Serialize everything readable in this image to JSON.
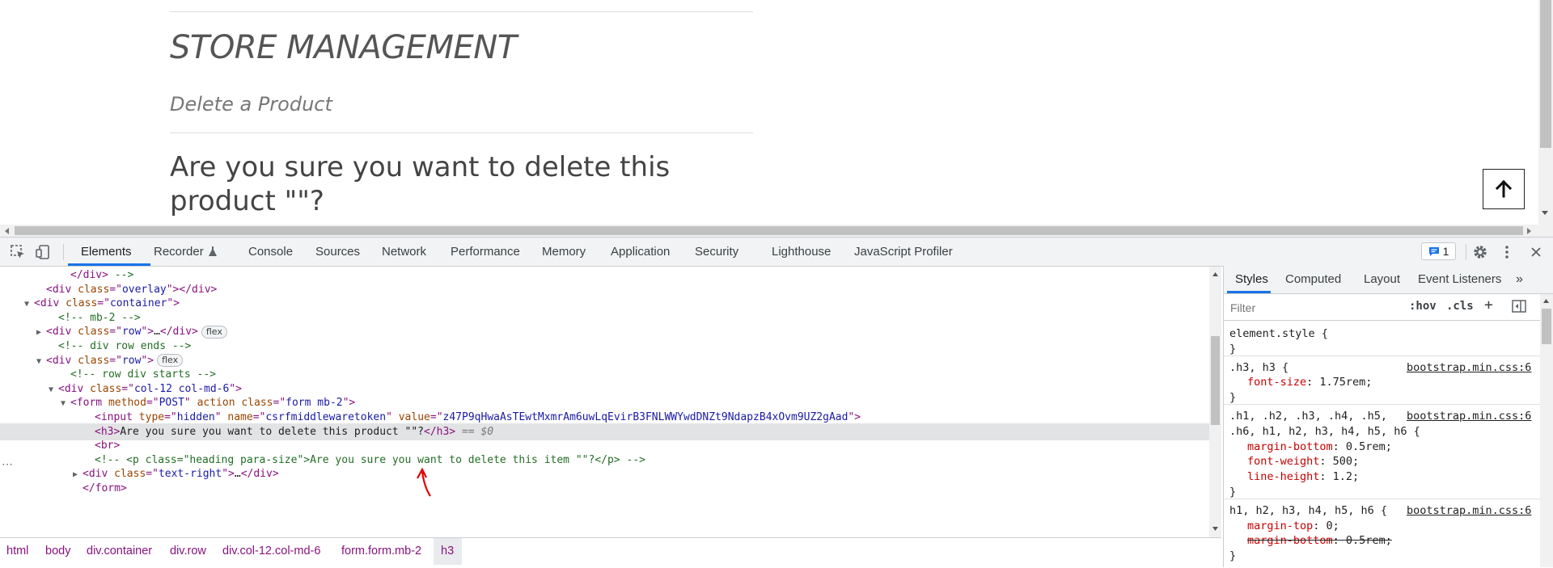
{
  "page": {
    "store_title": "STORE MANAGEMENT",
    "subtitle": "Delete a Product",
    "confirm_text": "Are you sure you want to delete this product \"\"?",
    "scroll_top_icon": "arrow-up-icon"
  },
  "devtools": {
    "tabs": [
      "Elements",
      "Recorder",
      "Console",
      "Sources",
      "Network",
      "Performance",
      "Memory",
      "Application",
      "Security",
      "Lighthouse",
      "JavaScript Profiler"
    ],
    "active_tab": "Elements",
    "issues_count": "1",
    "dom_lines": [
      {
        "indent": 5,
        "tri": "",
        "html": "<span class='tag'>&lt;/div&gt;</span> <span class='cmt'>--&gt;</span>"
      },
      {
        "indent": 3,
        "tri": "",
        "html": "<span class='tag'>&lt;div</span> <span class='attr'>class</span><span class='tag'>=\"</span><span class='val'>overlay</span><span class='tag'>\"&gt;&lt;/div&gt;</span>"
      },
      {
        "indent": 2,
        "tri": "▼",
        "html": "<span class='tag'>&lt;div</span> <span class='attr'>class</span><span class='tag'>=\"</span><span class='val'>container</span><span class='tag'>\"&gt;</span>"
      },
      {
        "indent": 4,
        "tri": "",
        "html": "<span class='cmt'>&lt;!-- mb-2 --&gt;</span>"
      },
      {
        "indent": 3,
        "tri": "▶",
        "html": "<span class='tag'>&lt;div</span> <span class='attr'>class</span><span class='tag'>=\"</span><span class='val'>row</span><span class='tag'>\"&gt;</span>…<span class='tag'>&lt;/div&gt;</span><span class='flexbadge'>flex</span>"
      },
      {
        "indent": 4,
        "tri": "",
        "html": "<span class='cmt'>&lt;!-- div row ends --&gt;</span>"
      },
      {
        "indent": 3,
        "tri": "▼",
        "html": "<span class='tag'>&lt;div</span> <span class='attr'>class</span><span class='tag'>=\"</span><span class='val'>row</span><span class='tag'>\"&gt;</span><span class='flexbadge'>flex</span>"
      },
      {
        "indent": 5,
        "tri": "",
        "html": "<span class='cmt'>&lt;!-- row div starts --&gt;</span>"
      },
      {
        "indent": 4,
        "tri": "▼",
        "html": "<span class='tag'>&lt;div</span> <span class='attr'>class</span><span class='tag'>=\"</span><span class='val'>col-12 col-md-6</span><span class='tag'>\"&gt;</span>"
      },
      {
        "indent": 5,
        "tri": "▼",
        "html": "<span class='tag'>&lt;form</span> <span class='attr'>method</span><span class='tag'>=\"</span><span class='val'>POST</span><span class='tag'>\"</span> <span class='attr'>action</span> <span class='attr'>class</span><span class='tag'>=\"</span><span class='val'>form mb-2</span><span class='tag'>\"&gt;</span>"
      },
      {
        "indent": 7,
        "tri": "",
        "html": "<span class='tag'>&lt;input</span> <span class='attr'>type</span><span class='tag'>=\"</span><span class='val'>hidden</span><span class='tag'>\"</span> <span class='attr'>name</span><span class='tag'>=\"</span><span class='val'>csrfmiddlewaretoken</span><span class='tag'>\"</span> <span class='attr'>value</span><span class='tag'>=\"</span><span class='val'>z47P9qHwaAsTEwtMxmrAm6uwLqEvirB3FNLWWYwdDNZt9NdapzB4xOvm9UZ2gAad</span><span class='tag'>\"&gt;</span>"
      },
      {
        "indent": 7,
        "tri": "",
        "sel": true,
        "html": "<span class='tag'>&lt;h3&gt;</span>Are you sure you want to delete this product \"\"?<span class='tag'>&lt;/h3&gt;</span> <span class='dim'>== $0</span>"
      },
      {
        "indent": 7,
        "tri": "",
        "html": "<span class='tag'>&lt;br&gt;</span>"
      },
      {
        "indent": 7,
        "tri": "",
        "html": "<span class='cmt'>&lt;!-- &lt;p class=\"heading para-size\"&gt;Are you sure you want to delete this item \"\"?&lt;/p&gt; --&gt;</span>"
      },
      {
        "indent": 6,
        "tri": "▶",
        "html": "<span class='tag'>&lt;div</span> <span class='attr'>class</span><span class='tag'>=\"</span><span class='val'>text-right</span><span class='tag'>\"&gt;</span>…<span class='tag'>&lt;/div&gt;</span>"
      },
      {
        "indent": 6,
        "tri": "",
        "html": "<span class='tag'>&lt;/form&gt;</span>"
      }
    ],
    "breadcrumbs": [
      "html",
      "body",
      "div.container",
      "div.row",
      "div.col-12.col-md-6",
      "form.form.mb-2",
      "h3"
    ],
    "styles_tabs": [
      "Styles",
      "Computed",
      "Layout",
      "Event Listeners"
    ],
    "filter_placeholder": "Filter",
    "filter_tools": [
      ":hov",
      ".cls",
      "+"
    ],
    "style_rules": [
      {
        "selector": "element.style {",
        "source": "",
        "props": []
      },
      {
        "selector": ".h3, h3 {",
        "source": "bootstrap.min.css:6",
        "props": [
          {
            "name": "font-size",
            "value": "1.75rem;"
          }
        ]
      },
      {
        "selector": ".h1, .h2, .h3, .h4, .h5,",
        "selector2": ".h6, h1, h2, h3, h4, h5, h6 {",
        "source": "bootstrap.min.css:6",
        "props": [
          {
            "name": "margin-bottom",
            "value": "0.5rem;"
          },
          {
            "name": "font-weight",
            "value": "500;"
          },
          {
            "name": "line-height",
            "value": "1.2;"
          }
        ]
      },
      {
        "selector": "h1, h2, h3, h4, h5, h6 {",
        "source": "bootstrap.min.css:6",
        "props": [
          {
            "name": "margin-top",
            "value": "0;"
          },
          {
            "name": "margin-bottom",
            "value": "0.5rem;",
            "struck": true
          }
        ]
      }
    ]
  }
}
